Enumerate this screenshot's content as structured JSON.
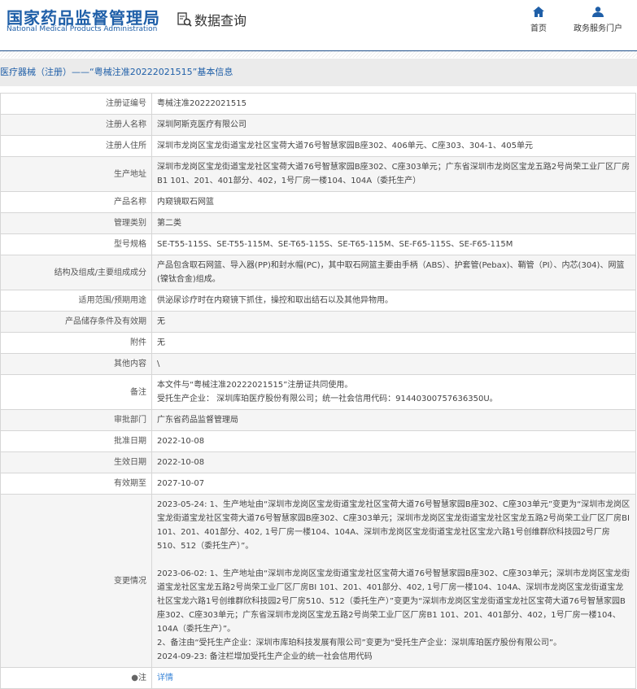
{
  "header": {
    "logo_cn": "国家药品监督管理局",
    "logo_en": "National Medical Products Administration",
    "section": "数据查询",
    "nav": [
      {
        "label": "首页",
        "icon": "home-icon"
      },
      {
        "label": "政务服务门户",
        "icon": "user-icon"
      }
    ]
  },
  "breadcrumb": "医疗器械（注册）——“粤械注准20222021515”基本信息",
  "rows": [
    {
      "label": "注册证编号",
      "value": "粤械注准20222021515"
    },
    {
      "label": "注册人名称",
      "value": "深圳阿斯克医疗有限公司"
    },
    {
      "label": "注册人住所",
      "value": "深圳市龙岗区宝龙街道宝龙社区宝荷大道76号智慧家园B座302、406单元、C座303、304-1、405单元"
    },
    {
      "label": "生产地址",
      "value": "深圳市龙岗区宝龙街道宝龙社区宝荷大道76号智慧家园B座302、C座303单元；广东省深圳市龙岗区宝龙五路2号尚荣工业厂区厂房B1 101、201、401部分、402，1号厂房一楼104、104A（委托生产）"
    },
    {
      "label": "产品名称",
      "value": "内窥镜取石网篮"
    },
    {
      "label": "管理类别",
      "value": "第二类"
    },
    {
      "label": "型号规格",
      "value": "SE-T55-115S、SE-T55-115M、SE-T65-115S、SE-T65-115M、SE-F65-115S、SE-F65-115M"
    },
    {
      "label": "结构及组成/主要组成成分",
      "value": "产品包含取石网篮、导入器(PP)和封水帽(PC)，其中取石网篮主要由手柄（ABS）、护套管(Pebax)、鞘管（PI）、内芯(304)、网篮(镍钛合金)组成。"
    },
    {
      "label": "适用范围/预期用途",
      "value": "供泌尿诊疗时在内窥镜下抓住，操控和取出结石以及其他异物用。"
    },
    {
      "label": "产品储存条件及有效期",
      "value": "无"
    },
    {
      "label": "附件",
      "value": "无"
    },
    {
      "label": "其他内容",
      "value": "\\"
    },
    {
      "label": "备注",
      "lines": [
        "本文件与“粤械注准20222021515”注册证共同使用。",
        "受托生产企业： 深圳库珀医疗股份有限公司；统一社会信用代码：91440300757636350U。"
      ]
    },
    {
      "label": "审批部门",
      "value": "广东省药品监督管理局"
    },
    {
      "label": "批准日期",
      "value": "2022-10-08"
    },
    {
      "label": "生效日期",
      "value": "2022-10-08"
    },
    {
      "label": "有效期至",
      "value": "2027-10-07"
    },
    {
      "label": "变更情况",
      "p1": "2023-05-24: 1、生产地址由“深圳市龙岗区宝龙街道宝龙社区宝荷大道76号智慧家园B座302、C座303单元”变更为“深圳市龙岗区宝龙街道宝龙社区宝荷大道76号智慧家园B座302、C座303单元；深圳市龙岗区宝龙街道宝龙社区宝龙五路2号尚荣工业厂区厂房BI 101、201、401部分、402, 1号厂房一楼104、104A、深圳市龙岗区宝龙街道宝龙社区宝龙六路1号创维群欣科技园2号厂房510、512（委托生产）”。",
      "p2": "2023-06-02: 1、生产地址由“深圳市龙岗区宝龙街道宝龙社区宝荷大道76号智慧家园B座302、C座303单元；深圳市龙岗区宝龙街道宝龙社区宝龙五路2号尚荣工业厂区厂房BI 101、201、401部分、402, 1号厂房一楼104、104A、深圳市龙岗区宝龙街道宝龙社区宝龙六路1号创维群欣科技园2号厂房510、512（委托生产）”变更为“深圳市龙岗区宝龙街道宝龙社区宝荷大道76号智慧家园B座302、C座303单元；广东省深圳市龙岗区宝龙五路2号尚荣工业厂区厂房B1 101、201、401部分、402，1号厂房一楼104、104A（委托生产）”。",
      "p3": "2、备注由“受托生产企业：深圳市库珀科技发展有限公司”变更为“受托生产企业：深圳库珀医疗股份有限公司”。",
      "p4": "2024-09-23: 备注栏增加受托生产企业的统一社会信用代码"
    },
    {
      "label": "注",
      "value": "详情"
    }
  ]
}
